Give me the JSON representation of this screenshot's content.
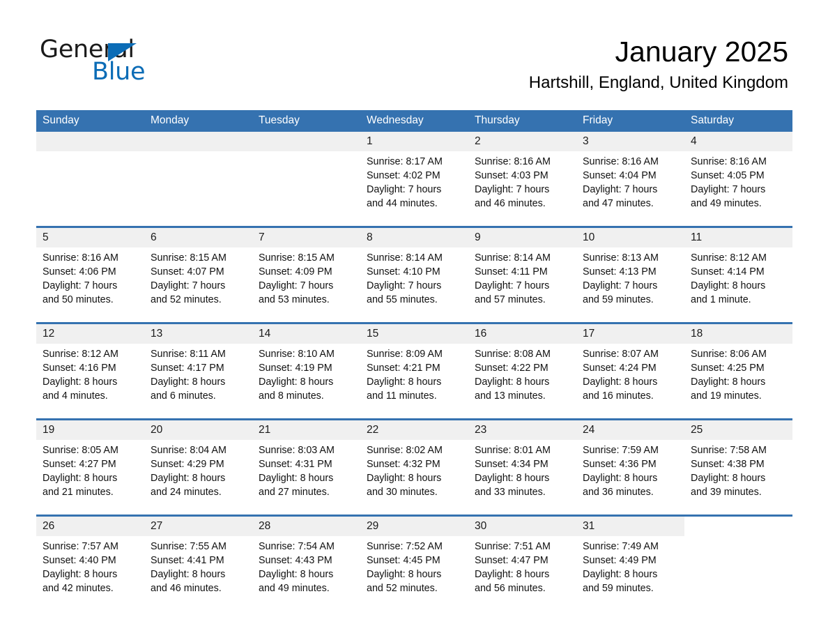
{
  "brand": {
    "name_part1": "General",
    "name_part2": "Blue",
    "triangle_color": "#0b6cb6",
    "accent_color": "#3572b0"
  },
  "header": {
    "title": "January 2025",
    "location": "Hartshill, England, United Kingdom"
  },
  "weekday_headers": [
    "Sunday",
    "Monday",
    "Tuesday",
    "Wednesday",
    "Thursday",
    "Friday",
    "Saturday"
  ],
  "weeks": [
    [
      {
        "day": "",
        "blank": true,
        "lines": []
      },
      {
        "day": "",
        "blank": true,
        "lines": []
      },
      {
        "day": "",
        "blank": true,
        "lines": []
      },
      {
        "day": "1",
        "lines": [
          "Sunrise: 8:17 AM",
          "Sunset: 4:02 PM",
          "Daylight: 7 hours",
          "and 44 minutes."
        ]
      },
      {
        "day": "2",
        "lines": [
          "Sunrise: 8:16 AM",
          "Sunset: 4:03 PM",
          "Daylight: 7 hours",
          "and 46 minutes."
        ]
      },
      {
        "day": "3",
        "lines": [
          "Sunrise: 8:16 AM",
          "Sunset: 4:04 PM",
          "Daylight: 7 hours",
          "and 47 minutes."
        ]
      },
      {
        "day": "4",
        "lines": [
          "Sunrise: 8:16 AM",
          "Sunset: 4:05 PM",
          "Daylight: 7 hours",
          "and 49 minutes."
        ]
      }
    ],
    [
      {
        "day": "5",
        "lines": [
          "Sunrise: 8:16 AM",
          "Sunset: 4:06 PM",
          "Daylight: 7 hours",
          "and 50 minutes."
        ]
      },
      {
        "day": "6",
        "lines": [
          "Sunrise: 8:15 AM",
          "Sunset: 4:07 PM",
          "Daylight: 7 hours",
          "and 52 minutes."
        ]
      },
      {
        "day": "7",
        "lines": [
          "Sunrise: 8:15 AM",
          "Sunset: 4:09 PM",
          "Daylight: 7 hours",
          "and 53 minutes."
        ]
      },
      {
        "day": "8",
        "lines": [
          "Sunrise: 8:14 AM",
          "Sunset: 4:10 PM",
          "Daylight: 7 hours",
          "and 55 minutes."
        ]
      },
      {
        "day": "9",
        "lines": [
          "Sunrise: 8:14 AM",
          "Sunset: 4:11 PM",
          "Daylight: 7 hours",
          "and 57 minutes."
        ]
      },
      {
        "day": "10",
        "lines": [
          "Sunrise: 8:13 AM",
          "Sunset: 4:13 PM",
          "Daylight: 7 hours",
          "and 59 minutes."
        ]
      },
      {
        "day": "11",
        "lines": [
          "Sunrise: 8:12 AM",
          "Sunset: 4:14 PM",
          "Daylight: 8 hours",
          "and 1 minute."
        ]
      }
    ],
    [
      {
        "day": "12",
        "lines": [
          "Sunrise: 8:12 AM",
          "Sunset: 4:16 PM",
          "Daylight: 8 hours",
          "and 4 minutes."
        ]
      },
      {
        "day": "13",
        "lines": [
          "Sunrise: 8:11 AM",
          "Sunset: 4:17 PM",
          "Daylight: 8 hours",
          "and 6 minutes."
        ]
      },
      {
        "day": "14",
        "lines": [
          "Sunrise: 8:10 AM",
          "Sunset: 4:19 PM",
          "Daylight: 8 hours",
          "and 8 minutes."
        ]
      },
      {
        "day": "15",
        "lines": [
          "Sunrise: 8:09 AM",
          "Sunset: 4:21 PM",
          "Daylight: 8 hours",
          "and 11 minutes."
        ]
      },
      {
        "day": "16",
        "lines": [
          "Sunrise: 8:08 AM",
          "Sunset: 4:22 PM",
          "Daylight: 8 hours",
          "and 13 minutes."
        ]
      },
      {
        "day": "17",
        "lines": [
          "Sunrise: 8:07 AM",
          "Sunset: 4:24 PM",
          "Daylight: 8 hours",
          "and 16 minutes."
        ]
      },
      {
        "day": "18",
        "lines": [
          "Sunrise: 8:06 AM",
          "Sunset: 4:25 PM",
          "Daylight: 8 hours",
          "and 19 minutes."
        ]
      }
    ],
    [
      {
        "day": "19",
        "lines": [
          "Sunrise: 8:05 AM",
          "Sunset: 4:27 PM",
          "Daylight: 8 hours",
          "and 21 minutes."
        ]
      },
      {
        "day": "20",
        "lines": [
          "Sunrise: 8:04 AM",
          "Sunset: 4:29 PM",
          "Daylight: 8 hours",
          "and 24 minutes."
        ]
      },
      {
        "day": "21",
        "lines": [
          "Sunrise: 8:03 AM",
          "Sunset: 4:31 PM",
          "Daylight: 8 hours",
          "and 27 minutes."
        ]
      },
      {
        "day": "22",
        "lines": [
          "Sunrise: 8:02 AM",
          "Sunset: 4:32 PM",
          "Daylight: 8 hours",
          "and 30 minutes."
        ]
      },
      {
        "day": "23",
        "lines": [
          "Sunrise: 8:01 AM",
          "Sunset: 4:34 PM",
          "Daylight: 8 hours",
          "and 33 minutes."
        ]
      },
      {
        "day": "24",
        "lines": [
          "Sunrise: 7:59 AM",
          "Sunset: 4:36 PM",
          "Daylight: 8 hours",
          "and 36 minutes."
        ]
      },
      {
        "day": "25",
        "lines": [
          "Sunrise: 7:58 AM",
          "Sunset: 4:38 PM",
          "Daylight: 8 hours",
          "and 39 minutes."
        ]
      }
    ],
    [
      {
        "day": "26",
        "lines": [
          "Sunrise: 7:57 AM",
          "Sunset: 4:40 PM",
          "Daylight: 8 hours",
          "and 42 minutes."
        ]
      },
      {
        "day": "27",
        "lines": [
          "Sunrise: 7:55 AM",
          "Sunset: 4:41 PM",
          "Daylight: 8 hours",
          "and 46 minutes."
        ]
      },
      {
        "day": "28",
        "lines": [
          "Sunrise: 7:54 AM",
          "Sunset: 4:43 PM",
          "Daylight: 8 hours",
          "and 49 minutes."
        ]
      },
      {
        "day": "29",
        "lines": [
          "Sunrise: 7:52 AM",
          "Sunset: 4:45 PM",
          "Daylight: 8 hours",
          "and 52 minutes."
        ]
      },
      {
        "day": "30",
        "lines": [
          "Sunrise: 7:51 AM",
          "Sunset: 4:47 PM",
          "Daylight: 8 hours",
          "and 56 minutes."
        ]
      },
      {
        "day": "31",
        "lines": [
          "Sunrise: 7:49 AM",
          "Sunset: 4:49 PM",
          "Daylight: 8 hours",
          "and 59 minutes."
        ]
      },
      {
        "day": "",
        "blank": true,
        "lines": []
      }
    ]
  ]
}
